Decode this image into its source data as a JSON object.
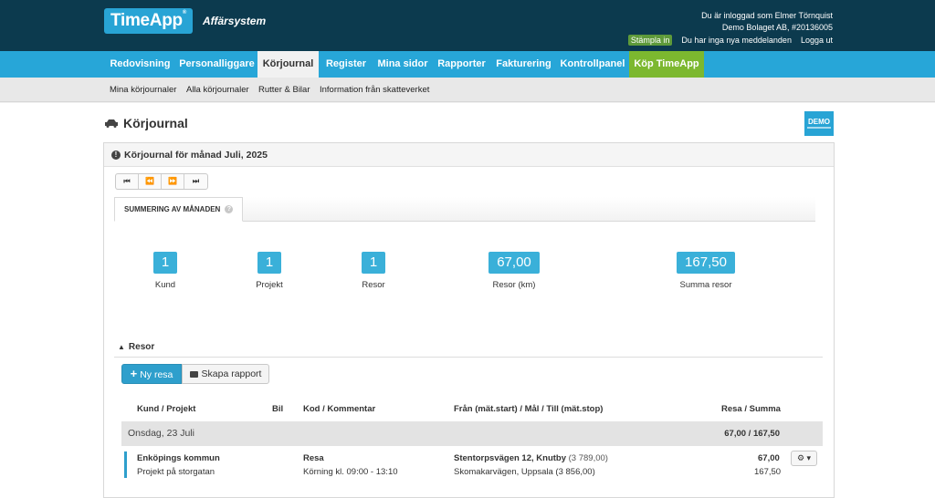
{
  "header": {
    "logo": "TimeApp",
    "logo_mark": "®",
    "subtitle": "Affärsystem",
    "user_line1": "Du är inloggad som Elmer Törnquist",
    "user_line2": "Demo Bolaget AB, #20136005",
    "stampla": "Stämpla in",
    "messages": "Du har inga nya meddelanden",
    "logout": "Logga ut"
  },
  "mainnav": [
    {
      "label": "Redovisning"
    },
    {
      "label": "Personalliggare"
    },
    {
      "label": "Körjournal"
    },
    {
      "label": "Register"
    },
    {
      "label": "Mina sidor"
    },
    {
      "label": "Rapporter"
    },
    {
      "label": "Fakturering"
    },
    {
      "label": "Kontrollpanel"
    },
    {
      "label": "Köp TimeApp"
    }
  ],
  "subnav": [
    {
      "label": "Mina körjournaler"
    },
    {
      "label": "Alla körjournaler"
    },
    {
      "label": "Rutter & Bilar"
    },
    {
      "label": "Information från skatteverket"
    }
  ],
  "page": {
    "title": "Körjournal",
    "demo_badge": "DEMO",
    "panel_title": "Körjournal för månad Juli, 2025",
    "pager": [
      "⏮",
      "⏪",
      "⏩",
      "⏭"
    ],
    "tab_label": "SUMMERING AV MÅNADEN",
    "tab_help": "?"
  },
  "stats": [
    {
      "value": "1",
      "label": "Kund"
    },
    {
      "value": "1",
      "label": "Projekt"
    },
    {
      "value": "1",
      "label": "Resor"
    },
    {
      "value": "67,00",
      "label": "Resor (km)"
    },
    {
      "value": "167,50",
      "label": "Summa resor"
    }
  ],
  "resor": {
    "section_label": "Resor",
    "new_button": "Ny resa",
    "report_button": "Skapa rapport",
    "columns": {
      "kund": "Kund / Projekt",
      "bil": "Bil",
      "kod": "Kod / Kommentar",
      "fran": "Från (mät.start) / Mål / Till (mät.stop)",
      "summa": "Resa / Summa"
    },
    "day": {
      "date": "Onsdag, 23 Juli",
      "sum": "67,00 / 167,50"
    },
    "row": {
      "kund": "Enköpings kommun",
      "projekt": "Projekt på storgatan",
      "kod": "Resa",
      "kommentar": "Körning kl. 09:00 - 13:10",
      "fran": "Stentorpsvägen 12, Knutby",
      "fran_mat": "(3 789,00)",
      "till": "Skomakarvägen, Uppsala (3 856,00)",
      "resa": "67,00",
      "summa": "167,50"
    }
  },
  "colors": {
    "header_bg": "#0c3a4e",
    "nav_bg": "#27a6d8",
    "buy_bg": "#7cb82f",
    "stat_bg": "#3ab0d9"
  }
}
